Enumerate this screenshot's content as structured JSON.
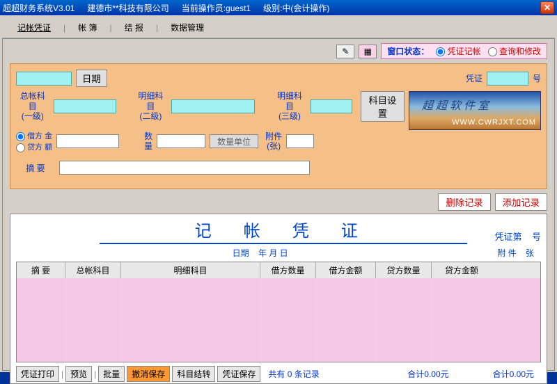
{
  "titlebar": {
    "app": "超超财务系统V3.01",
    "company": "建德市**科技有限公司",
    "operator_label": "当前操作员:guest1",
    "level_label": "级别:中(会计操作)"
  },
  "menu": {
    "voucher": "记帐凭证",
    "ledger": "帐   簿",
    "report": "结   报",
    "data": "数据管理"
  },
  "status": {
    "label": "窗口状态：",
    "opt1": "凭证记帐",
    "opt2": "查询和修改"
  },
  "form": {
    "date_btn": "日期",
    "voucher_label": "凭证",
    "voucher_suffix": "号",
    "acct1": "总帐科目\n(一级)",
    "acct2": "明细科目\n(二级)",
    "acct3": "明细科目\n(三级)",
    "acct_setup": "科目设置",
    "debit": "借方 金",
    "credit": "贷方 额",
    "qty": "数\n量",
    "qty_unit": "数量单位",
    "attach": "附件\n(张)",
    "summary": "摘   要"
  },
  "banner": {
    "t1": "超超软件室",
    "t2": "WWW.CWRJXT.COM"
  },
  "rec": {
    "del": "删除记录",
    "add": "添加记录"
  },
  "voucher": {
    "title": "记 帐 凭 证",
    "no_label": "凭证第",
    "no_suffix": "号",
    "date_label": "日期",
    "date_fmt": "年 月 日",
    "attach_label": "附  件",
    "attach_suffix": "张",
    "cols": {
      "c0": "摘 要",
      "c1": "总帐科目",
      "c2": "明细科目",
      "c3": "借方数量",
      "c4": "借方金额",
      "c5": "贷方数量",
      "c6": "贷方金额"
    }
  },
  "footer": {
    "print": "凭证打印",
    "preview": "预览",
    "batch": "批量",
    "undo": "撤消保存",
    "item_close": "科目结转",
    "save": "凭证保存",
    "count_prefix": "共有",
    "count": "0",
    "count_suffix": "条记录",
    "sum1": "合计0.00元",
    "sum2": "合计0.00元"
  }
}
